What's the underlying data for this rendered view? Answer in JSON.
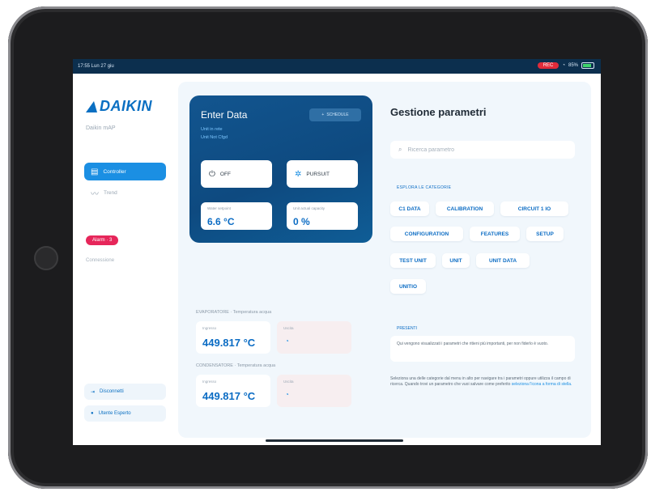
{
  "status_bar": {
    "time": "17:55 Lun 27 giu",
    "recording": "REC",
    "battery": "85%"
  },
  "sidebar": {
    "logo": "DAIKIN",
    "app_name": "Daikin mAP",
    "nav": [
      {
        "label": "Controller",
        "icon": "grid-icon",
        "active": true
      },
      {
        "label": "Trend",
        "icon": "trend-icon",
        "active": false
      }
    ],
    "alarm_badge": "Alarm · 3",
    "link": "Connessione",
    "bottom_buttons": [
      {
        "label": "Disconnetti",
        "icon": "logout-icon"
      },
      {
        "label": "Utente Esperto",
        "icon": "user-icon"
      }
    ]
  },
  "enter_data": {
    "title": "Enter Data",
    "subtitle_1": "Unit in rete",
    "subtitle_2": "Unit Not Cfgd",
    "header_button": "SCHEDULE",
    "off_label": "OFF",
    "pursuit_label": "PURSUIT",
    "metric_1": {
      "label": "Water setpoint",
      "value": "6.6 °C"
    },
    "metric_2": {
      "label": "Unit actual capacity",
      "value": "0 %"
    }
  },
  "evaporation": {
    "label": "EVAPORATORE · Temperatura acqua",
    "value_label": "Ingresso",
    "value": "449.817 °C",
    "status_label": "Uscita"
  },
  "condensation": {
    "label": "CONDENSATORE · Temperatura acqua",
    "value_label": "Ingresso",
    "value": "449.817 °C",
    "status_label": "Uscita"
  },
  "parameters": {
    "title": "Gestione parametri",
    "search_placeholder": "Ricerca parametro",
    "categories_label": "ESPLORA LE CATEGORIE",
    "categories": [
      "C1 DATA",
      "CALIBRATION",
      "CIRCUIT 1 IO",
      "CONFIGURATION",
      "FEATURES",
      "SETUP",
      "TEST UNIT",
      "UNIT",
      "UNIT DATA",
      "UNITIO"
    ],
    "presets_label": "PRESENTI",
    "presets_text": "Qui vengono visualizzati i parametri che ritieni più importanti, per non fiderlo è vuoto.",
    "help_text": "Seleziona una delle categorie dal menu in alto per navigare tra i parametri oppure utilizza il campo di ricerca. Quando trovi un parametro che vuoi salvare come preferito",
    "help_link": "seleziona l'icona a forma di stella."
  }
}
